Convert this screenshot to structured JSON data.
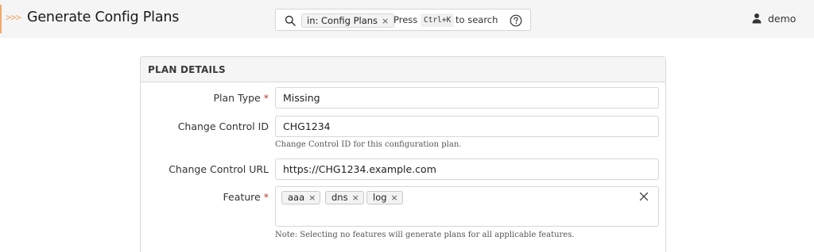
{
  "header": {
    "chevrons": ">>>",
    "title": "Generate Config Plans",
    "search": {
      "scope_chip": "in: Config Plans",
      "scope_remove": "×",
      "press_label": "Press",
      "shortcut": "Ctrl+K",
      "to_search_label": "to search"
    },
    "user": {
      "name": "demo"
    }
  },
  "panel": {
    "title": "PLAN DETAILS",
    "fields": {
      "plan_type": {
        "label": "Plan Type",
        "required_mark": "*",
        "value": "Missing"
      },
      "change_control_id": {
        "label": "Change Control ID",
        "value": "CHG1234",
        "help": "Change Control ID for this configuration plan."
      },
      "change_control_url": {
        "label": "Change Control URL",
        "value": "https://CHG1234.example.com"
      },
      "feature": {
        "label": "Feature",
        "required_mark": "*",
        "chips": [
          "aaa",
          "dns",
          "log"
        ],
        "chip_remove": "×",
        "help": "Note: Selecting no features will generate plans for all applicable features."
      }
    }
  },
  "colors": {
    "accent": "#f0a868",
    "required": "#c0392b",
    "header_bg": "#f5f5f5"
  },
  "icons": {
    "search": "search-icon",
    "help": "question-circle-icon",
    "user": "user-icon",
    "clear": "close-icon"
  }
}
